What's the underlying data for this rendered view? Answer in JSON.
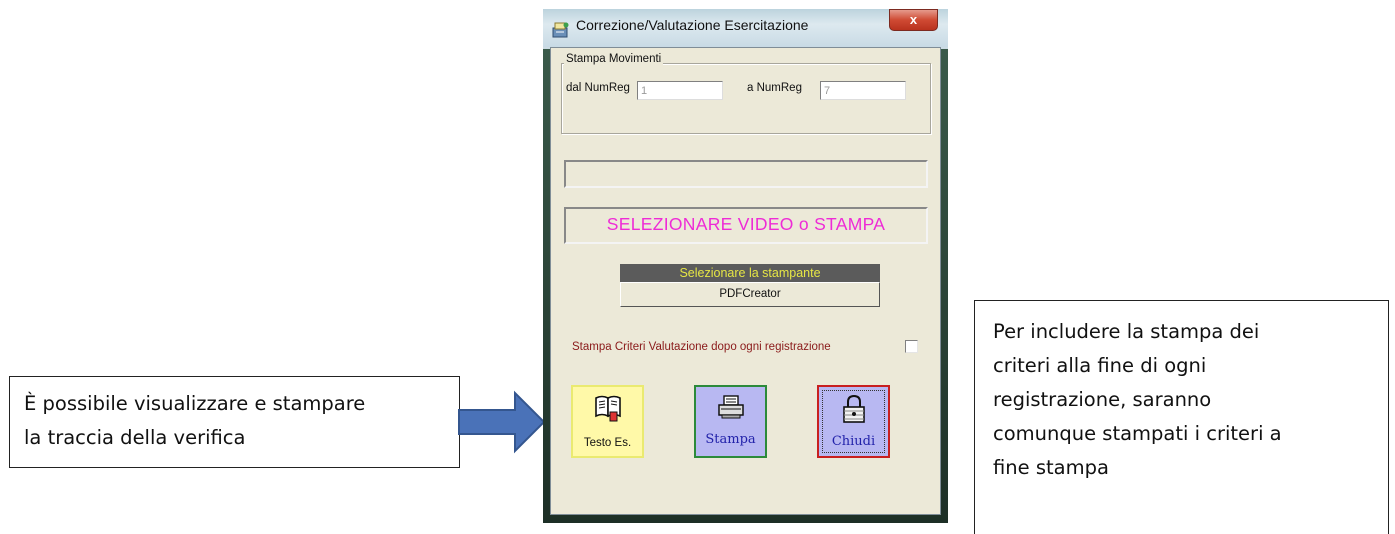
{
  "window": {
    "title": "Correzione/Valutazione Esercitazione",
    "close_glyph": "x"
  },
  "stampa_movimenti": {
    "legend": "Stampa Movimenti",
    "from_label": "dal NumReg",
    "from_value": "1",
    "to_label": "a NumReg",
    "to_value": "7"
  },
  "status": {
    "empty_text": "",
    "message": "SELEZIONARE  VIDEO o STAMPA",
    "message_color": "#ee2bd6"
  },
  "printer": {
    "header": "Selezionare la stampante",
    "selected": "PDFCreator"
  },
  "criteri": {
    "label": "Stampa Criteri Valutazione dopo ogni registrazione",
    "checked": false
  },
  "buttons": {
    "testo": {
      "label": "Testo Es.",
      "icon": "book-icon"
    },
    "stampa": {
      "label": "Stampa",
      "icon": "printer-icon"
    },
    "chiudi": {
      "label": "Chiudi",
      "icon": "padlock-icon"
    }
  },
  "callouts": {
    "left_line1": "È possibile visualizzare e stampare",
    "left_line2": "la traccia della verifica",
    "right_line1": "Per includere la stampa dei",
    "right_line2": "criteri alla fine di ogni",
    "right_line3": "registrazione, saranno",
    "right_line4": "comunque stampati i criteri a",
    "right_line5": "fine stampa"
  }
}
